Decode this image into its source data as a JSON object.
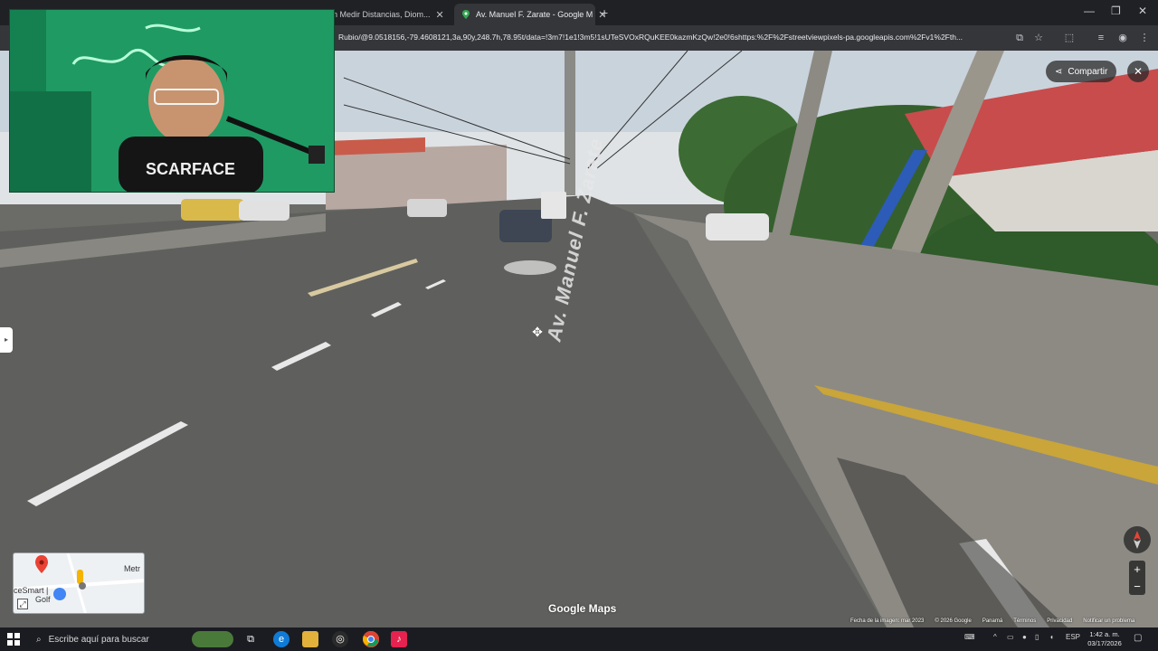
{
  "browser": {
    "tabs": [
      {
        "label": "n Medir Distancias, Diom..."
      },
      {
        "label": "Av. Manuel F. Zarate - Google M"
      }
    ],
    "new_tab": "+",
    "url": "Rubio/@9.0518156,-79.4608121,3a,90y,248.7h,78.95t/data=!3m7!1e1!3m5!1sUTeSVOxRQuKEE0kazmKzQw!2e0!6shttps:%2F%2Fstreetviewpixels-pa.googleapis.com%2Fv1%2Fth...",
    "window_controls": {
      "minimize": "—",
      "restore": "❐",
      "close": "✕"
    }
  },
  "streetview": {
    "share_label": "Compartir",
    "close_label": "✕",
    "road_name": "Av. Manuel F. Zarate",
    "watermark": "Google Maps",
    "minimap": {
      "label_1": "Metr",
      "label_2": "ceSmart |",
      "label_3": "Golf"
    },
    "zoom_in": "+",
    "zoom_out": "−",
    "footer": [
      "Fecha de la imagen: mar 2023",
      "© 2026 Google",
      "Panamá",
      "Términos",
      "Privacidad",
      "Notificar un problema"
    ]
  },
  "taskbar": {
    "search_placeholder": "Escribe aquí para buscar",
    "language": "ESP",
    "time": "1:42 a. m.",
    "date": "03/17/2026"
  },
  "colors": {
    "chrome_dark": "#202124",
    "chrome_mid": "#35363a",
    "webcam_green": "#1e8a5a",
    "taskbar": "#1b1c22"
  }
}
